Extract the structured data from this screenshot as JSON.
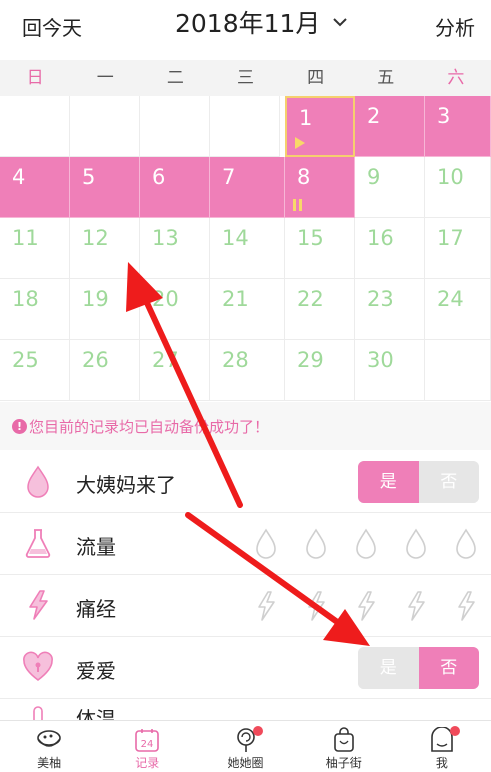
{
  "header": {
    "today_label": "回今天",
    "month_label": "2018年11月",
    "analysis_label": "分析"
  },
  "weekdays": [
    "日",
    "一",
    "二",
    "三",
    "四",
    "五",
    "六"
  ],
  "calendar": {
    "days": [
      "1",
      "2",
      "3",
      "4",
      "5",
      "6",
      "7",
      "8",
      "9",
      "10",
      "11",
      "12",
      "13",
      "14",
      "15",
      "16",
      "17",
      "18",
      "19",
      "20",
      "21",
      "22",
      "23",
      "24",
      "25",
      "26",
      "27",
      "28",
      "29",
      "30"
    ]
  },
  "notice": {
    "text": "您目前的记录均已自动备份成功了！"
  },
  "records": {
    "period": {
      "label": "大姨妈来了",
      "yes": "是",
      "no": "否"
    },
    "flow": {
      "label": "流量"
    },
    "cramps": {
      "label": "痛经"
    },
    "love": {
      "label": "爱爱",
      "yes": "是",
      "no": "否"
    },
    "partial": {
      "label": "体温"
    }
  },
  "nav": {
    "tabs": [
      {
        "label": "美柚"
      },
      {
        "label": "记录"
      },
      {
        "label": "她她圈"
      },
      {
        "label": "柚子街"
      },
      {
        "label": "我"
      }
    ],
    "calendar_icon_number": "24"
  },
  "colors": {
    "accent_pink": "#ef7fb8",
    "text_pink": "#e86aa8",
    "future_day_green": "#9fd99a",
    "annotation_red": "#ee1c1c"
  }
}
